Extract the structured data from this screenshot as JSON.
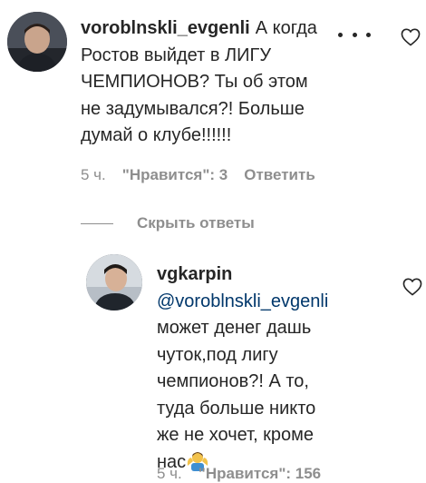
{
  "comments": [
    {
      "username": "voroblnskli_evgenli",
      "text": "А когда Ростов выйдет в ЛИГУ ЧЕМПИОНОВ? Ты об этом не задумывался?! Больше думай о клубе!!!!!!",
      "time": "5 ч.",
      "likes": "\"Нравится\": 3",
      "reply_label": "Ответить"
    },
    {
      "username": "vgkarpin",
      "mention": "@voroblnskli_evgenli",
      "text": "может денег дашь чуток,под лигу чемпионов?! А то, туда больше никто же не хочет, кроме нас",
      "emoji": "person-shrugging",
      "time": "5 ч.",
      "likes": "\"Нравится\": 156"
    }
  ],
  "hide_replies_label": "Скрыть ответы",
  "icons": {
    "like": "heart-outline-icon",
    "more": "more-options-icon"
  },
  "colors": {
    "text": "#262626",
    "meta": "#8e8e8e",
    "mention": "#00376b"
  }
}
